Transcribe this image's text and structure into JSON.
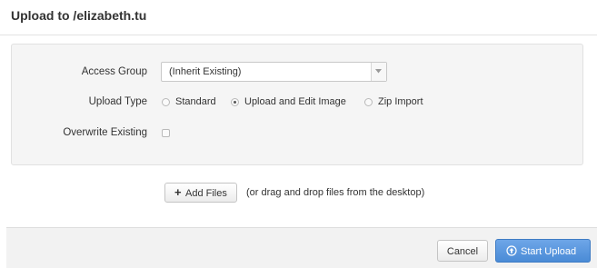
{
  "dialog": {
    "title": "Upload to /elizabeth.tu"
  },
  "form": {
    "access_group": {
      "label": "Access Group",
      "value": "(Inherit Existing)"
    },
    "upload_type": {
      "label": "Upload Type",
      "options": [
        {
          "label": "Standard",
          "selected": false
        },
        {
          "label": "Upload and Edit Image",
          "selected": true
        },
        {
          "label": "Zip Import",
          "selected": false
        }
      ]
    },
    "overwrite": {
      "label": "Overwrite Existing",
      "checked": false
    }
  },
  "upload": {
    "add_files_label": "Add Files",
    "drag_hint": "(or drag and drop files from the desktop)"
  },
  "footer": {
    "cancel_label": "Cancel",
    "start_label": "Start Upload"
  },
  "colors": {
    "primary": "#4a8bd6",
    "well_bg": "#f5f5f5",
    "footer_bg": "#f2f2f2"
  },
  "icons": {
    "add": "plus-icon",
    "start": "upload-circle-icon",
    "select": "chevron-down-icon"
  }
}
